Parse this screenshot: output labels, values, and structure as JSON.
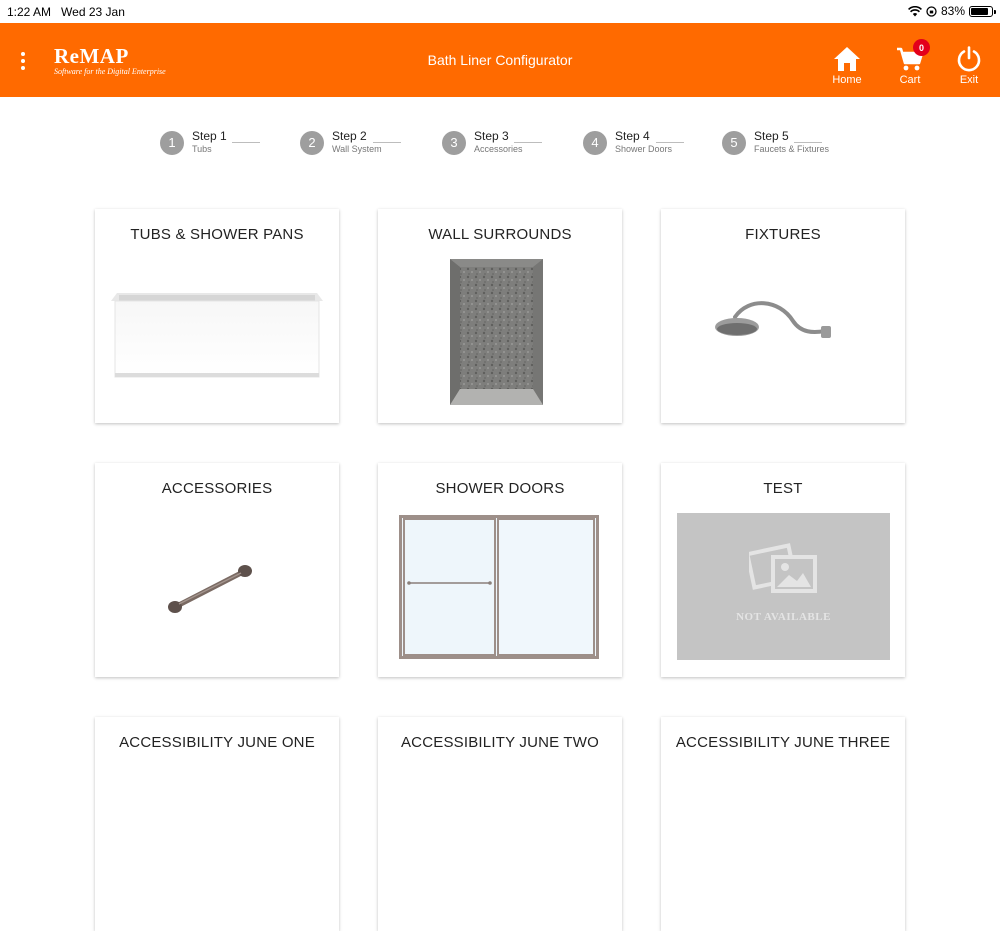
{
  "status": {
    "time": "1:22 AM",
    "date": "Wed 23 Jan",
    "battery": "83%",
    "battery_level": 0.83
  },
  "header": {
    "logo_title": "ReMAP",
    "logo_subtitle": "Software for the Digital Enterprise",
    "title": "Bath Liner Configurator",
    "home_label": "Home",
    "cart_label": "Cart",
    "cart_count": "0",
    "exit_label": "Exit",
    "accent": "#ff6a00"
  },
  "steps": [
    {
      "num": "1",
      "title": "Step 1",
      "sub": "Tubs"
    },
    {
      "num": "2",
      "title": "Step 2",
      "sub": "Wall System"
    },
    {
      "num": "3",
      "title": "Step 3",
      "sub": "Accessories"
    },
    {
      "num": "4",
      "title": "Step 4",
      "sub": "Shower Doors"
    },
    {
      "num": "5",
      "title": "Step 5",
      "sub": "Faucets & Fixtures"
    }
  ],
  "cards": [
    {
      "title": "TUBS & SHOWER PANS",
      "image": "bathtub-image"
    },
    {
      "title": "WALL SURROUNDS",
      "image": "wall-surround-image"
    },
    {
      "title": "FIXTURES",
      "image": "shower-head-image"
    },
    {
      "title": "ACCESSORIES",
      "image": "grab-bar-image"
    },
    {
      "title": "SHOWER DOORS",
      "image": "shower-door-image"
    },
    {
      "title": "TEST",
      "image": "not-available-image",
      "placeholder_text": "NOT AVAILABLE"
    },
    {
      "title": "ACCESSIBILITY JUNE ONE"
    },
    {
      "title": "ACCESSIBILITY JUNE TWO"
    },
    {
      "title": "ACCESSIBILITY JUNE THREE"
    }
  ]
}
